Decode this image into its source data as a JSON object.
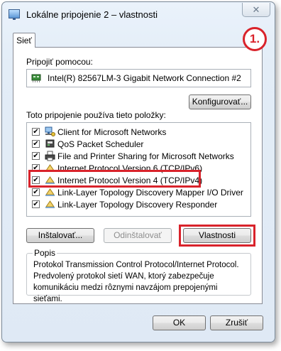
{
  "window": {
    "title": "Lokálne pripojenie 2 – vlastnosti",
    "close_symbol": "✕",
    "app_icon": "network-connection-icon"
  },
  "tabs": [
    {
      "label": "Sieť"
    }
  ],
  "annotation": {
    "badge": "1."
  },
  "connect_using": {
    "label": "Pripojiť pomocou:",
    "adapter": "Intel(R) 82567LM-3 Gigabit Network Connection #2",
    "adapter_icon": "network-adapter-icon",
    "configure_button": "Konfigurovať..."
  },
  "items_section": {
    "label": "Toto pripojenie používa tieto položky:",
    "items": [
      {
        "label": "Client for Microsoft Networks",
        "checked": true,
        "icon": "network-client-icon"
      },
      {
        "label": "QoS Packet Scheduler",
        "checked": true,
        "icon": "network-service-icon"
      },
      {
        "label": "File and Printer Sharing for Microsoft Networks",
        "checked": true,
        "icon": "printer-icon"
      },
      {
        "label": "Internet Protocol Version 6 (TCP/IPv6)",
        "checked": true,
        "icon": "protocol-icon"
      },
      {
        "label": "Internet Protocol Version 4 (TCP/IPv4)",
        "checked": true,
        "icon": "protocol-icon",
        "highlighted": true
      },
      {
        "label": "Link-Layer Topology Discovery Mapper I/O Driver",
        "checked": true,
        "icon": "protocol-icon"
      },
      {
        "label": "Link-Layer Topology Discovery Responder",
        "checked": true,
        "icon": "protocol-icon"
      }
    ],
    "check_symbol": "✔"
  },
  "actions": {
    "install": "Inštalovať...",
    "uninstall": "Odinštalovať",
    "properties": "Vlastnosti"
  },
  "description": {
    "title": "Popis",
    "text": "Protokol Transmission Control Protocol/Internet Protocol. Predvolený protokol sietí WAN, ktorý zabezpečuje komunikáciu medzi rôznymi navzájom prepojenými sieťami."
  },
  "footer": {
    "ok": "OK",
    "cancel": "Zrušiť"
  },
  "colors": {
    "annotation_red": "#d9232b",
    "window_bg": "#dfe9f5"
  }
}
